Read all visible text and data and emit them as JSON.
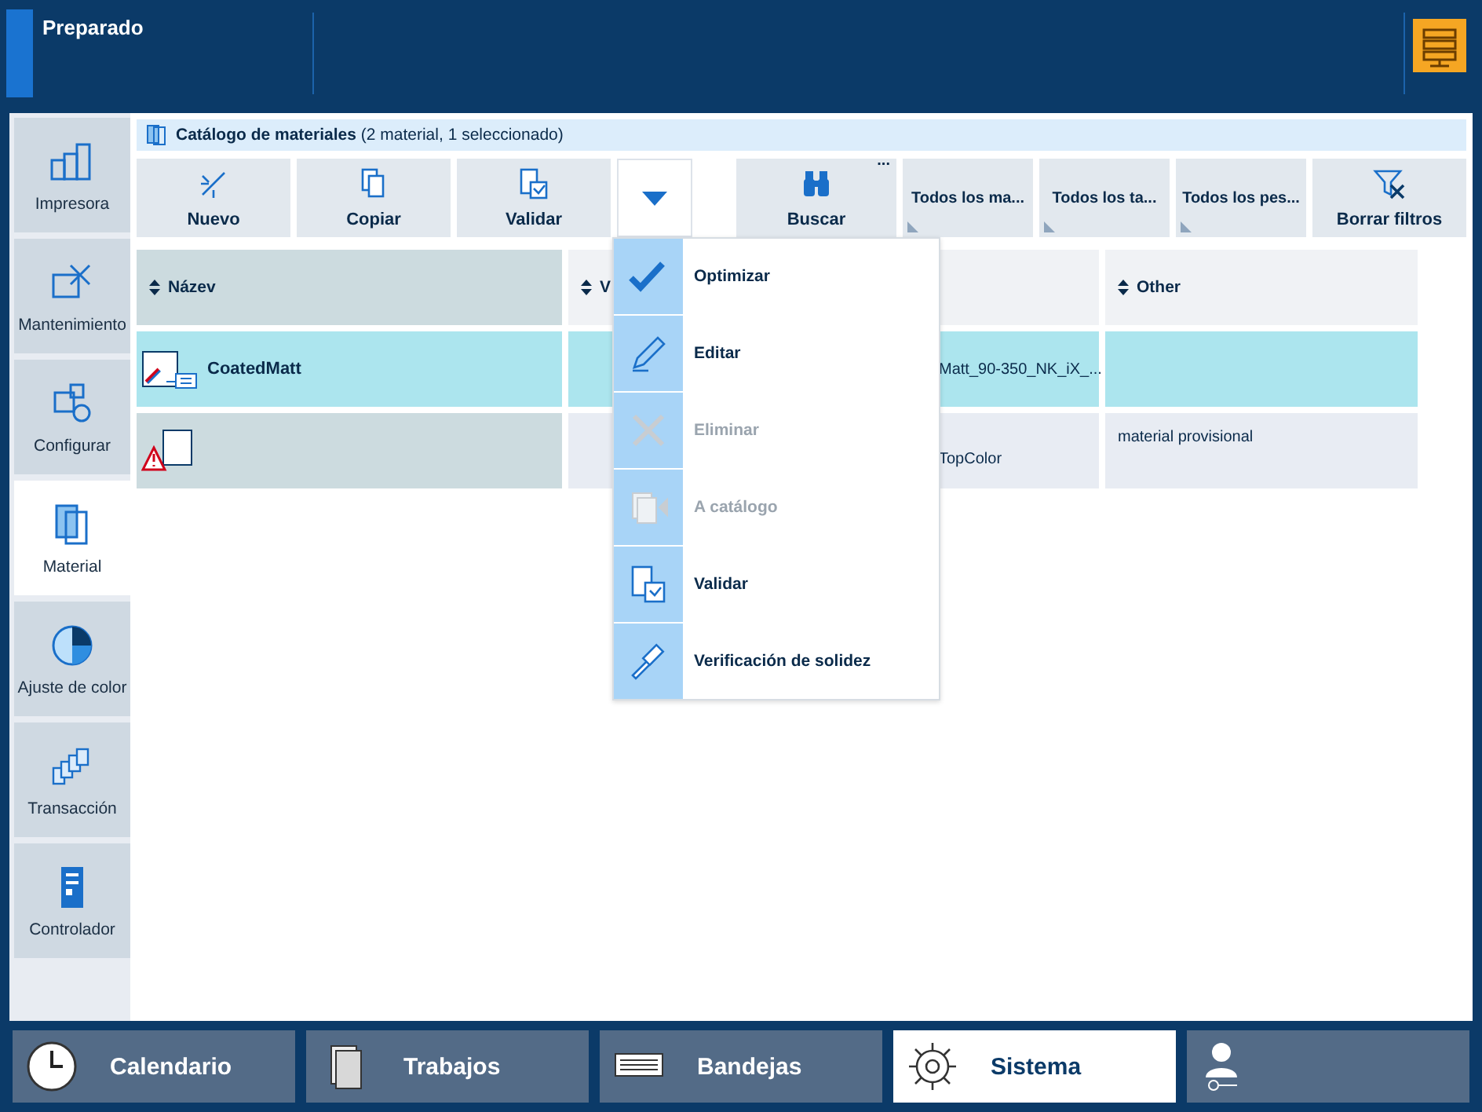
{
  "header": {
    "status": "Preparado"
  },
  "sidebar": {
    "items": [
      {
        "kind": "printer",
        "label": "Impresora",
        "selected": false
      },
      {
        "kind": "maintenance",
        "label": "Mantenimiento",
        "selected": false
      },
      {
        "kind": "configure",
        "label": "Configurar",
        "selected": false
      },
      {
        "kind": "material",
        "label": "Material",
        "selected": true
      },
      {
        "kind": "color",
        "label": "Ajuste de color",
        "selected": false
      },
      {
        "kind": "transaction",
        "label": "Transacción",
        "selected": false
      },
      {
        "kind": "controller",
        "label": "Controlador",
        "selected": false
      }
    ]
  },
  "catalog": {
    "title": "Catálogo de materiales",
    "summary": "(2 material, 1 seleccionado)"
  },
  "toolbar": {
    "buttons": [
      {
        "kind": "new",
        "label": "Nuevo"
      },
      {
        "kind": "copy",
        "label": "Copiar"
      },
      {
        "kind": "validate",
        "label": "Validar"
      }
    ],
    "dropdown": {
      "expanded": true
    },
    "search": {
      "label": "Buscar",
      "more": "..."
    },
    "filters": [
      {
        "label": "Todos los ma..."
      },
      {
        "label": "Todos los ta..."
      },
      {
        "label": "Todos los pes..."
      }
    ],
    "clear": {
      "label": "Borrar filtros"
    }
  },
  "table": {
    "columns": [
      {
        "label": "Název"
      },
      {
        "label": "V"
      },
      {
        "label": "Other"
      }
    ],
    "rows": [
      {
        "selected": true,
        "warning": false,
        "name": "CoatedMatt",
        "column_3": "Matt_90-350_NK_iX_..."
      },
      {
        "selected": false,
        "warning": true,
        "column_3": "TopColor",
        "other": "material provisional"
      }
    ]
  },
  "menu": {
    "items": [
      {
        "kind": "optimize",
        "label": "Optimizar",
        "disabled": false
      },
      {
        "kind": "edit",
        "label": "Editar",
        "disabled": false
      },
      {
        "kind": "delete",
        "label": "Eliminar",
        "disabled": true
      },
      {
        "kind": "catalog",
        "label": "A catálogo",
        "disabled": true
      },
      {
        "kind": "validate",
        "label": "Validar",
        "disabled": false
      },
      {
        "kind": "hammer",
        "label": "Verificación de solidez",
        "disabled": false
      }
    ]
  },
  "bottom_tabs": [
    {
      "kind": "clock",
      "label": "Calendario",
      "selected": false
    },
    {
      "kind": "jobs",
      "label": "Trabajos",
      "selected": false
    },
    {
      "kind": "trays",
      "label": "Bandejas",
      "selected": false
    },
    {
      "kind": "gear",
      "label": "Sistema",
      "selected": true
    },
    {
      "kind": "user",
      "selected": false
    }
  ]
}
